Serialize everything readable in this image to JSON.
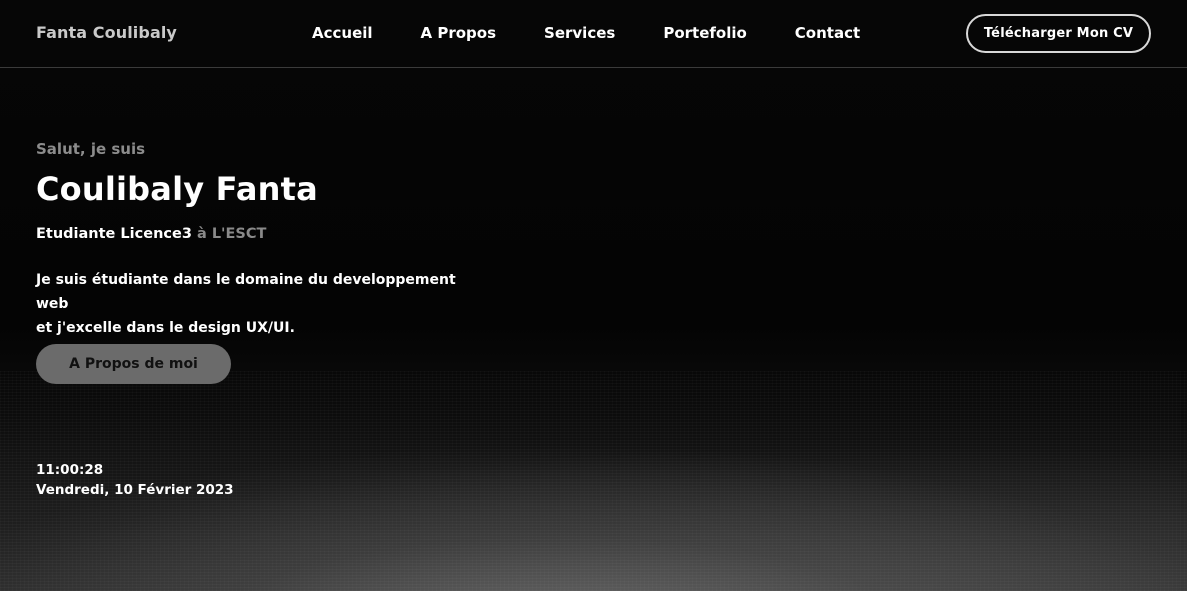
{
  "brand": "Fanta Coulibaly",
  "nav": {
    "items": [
      {
        "label": "Accueil"
      },
      {
        "label": "A Propos"
      },
      {
        "label": "Services"
      },
      {
        "label": "Portefolio"
      },
      {
        "label": "Contact"
      }
    ],
    "cv_button": "Télécharger Mon CV"
  },
  "hero": {
    "greeting": "Salut, je suis",
    "name": "Coulibaly Fanta",
    "level": "Etudiante Licence3",
    "school": "à L'ESCT",
    "description_line1": "Je suis étudiante dans le domaine du developpement web",
    "description_line2": "et j'excelle dans le design UX/UI.",
    "about_button": "A Propos de moi"
  },
  "clock": {
    "time": "11:00:28",
    "date": "Vendredi, 10 Février 2023"
  },
  "colors": {
    "background": "#000000",
    "muted_text": "#8c8c8c",
    "button_fill": "#6b6b6b"
  }
}
